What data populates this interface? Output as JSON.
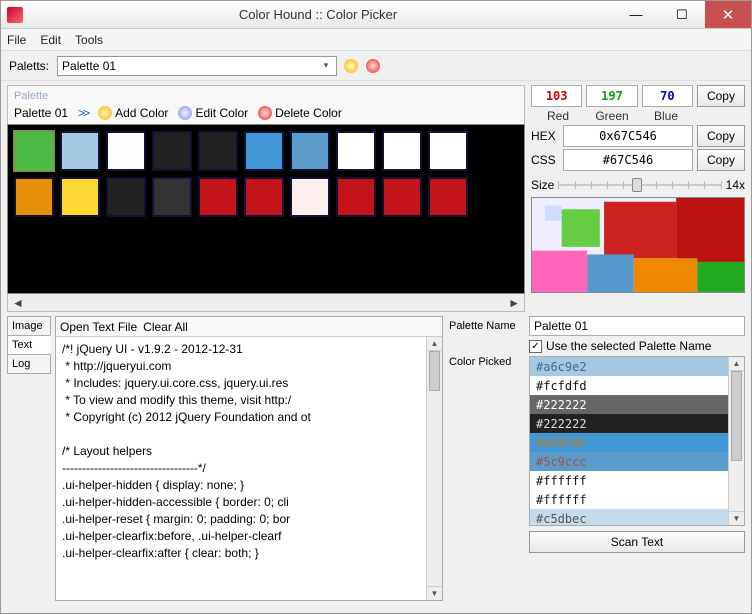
{
  "window": {
    "title": "Color Hound :: Color Picker",
    "min": "—",
    "max": "☐",
    "close": "✕"
  },
  "menu": [
    "File",
    "Edit",
    "Tools"
  ],
  "toolbar": {
    "palettes_label": "Paletts:",
    "palette_selected": "Palette 01"
  },
  "palette": {
    "group": "Palette",
    "name": "Palette 01",
    "arrows": ">>",
    "add": "Add Color",
    "edit": "Edit Color",
    "del": "Delete Color",
    "row1": [
      "#4cb944",
      "#a6c9e2",
      "#fcfdfd",
      "#222222",
      "#222222",
      "#4297d7",
      "#5c9ccc",
      "#ffffff",
      "#ffffff",
      "#ffffff"
    ],
    "row2": [
      "#e78f08",
      "#fdd835",
      "#222222",
      "#333333",
      "#c5131a",
      "#c5131a",
      "#fcefee",
      "#c5131a",
      "#c5131a",
      "#c5131a"
    ]
  },
  "rgb": {
    "r": "103",
    "g": "197",
    "b": "70",
    "rl": "Red",
    "gl": "Green",
    "bl": "Blue"
  },
  "hex": {
    "label": "HEX",
    "value": "0x67C546"
  },
  "css": {
    "label": "CSS",
    "value": "#67C546"
  },
  "copy": "Copy",
  "size": {
    "label": "Size",
    "value": "14x"
  },
  "tabs": [
    "Image",
    "Text",
    "Log"
  ],
  "text_toolbar": {
    "open": "Open Text File",
    "clear": "Clear All"
  },
  "text_body": "/*! jQuery UI - v1.9.2 - 2012-12-31\n * http://jqueryui.com\n * Includes: jquery.ui.core.css, jquery.ui.res\n * To view and modify this theme, visit http:/\n * Copyright (c) 2012 jQuery Foundation and ot\n\n/* Layout helpers\n----------------------------------*/\n.ui-helper-hidden { display: none; }\n.ui-helper-hidden-accessible { border: 0; cli\n.ui-helper-reset { margin: 0; padding: 0; bor\n.ui-helper-clearfix:before, .ui-helper-clearf\n.ui-helper-clearfix:after { clear: both; }",
  "palette_name": {
    "label": "Palette Name",
    "value": "Palette 01"
  },
  "use_sel": "Use the selected Palette Name",
  "color_picked": {
    "label": "Color Picked"
  },
  "picked": [
    {
      "hex": "#a6c9e2",
      "bg": "#a6c9e2",
      "fg": "#3a6b9a"
    },
    {
      "hex": "#fcfdfd",
      "bg": "#fcfdfd",
      "fg": "#111"
    },
    {
      "hex": "#222222",
      "bg": "#666",
      "fg": "#fff"
    },
    {
      "hex": "#222222",
      "bg": "#222",
      "fg": "#ddd"
    },
    {
      "hex": "#4297d7",
      "bg": "#4297d7",
      "fg": "#c97b1a"
    },
    {
      "hex": "#5c9ccc",
      "bg": "#5c9ccc",
      "fg": "#b04a3a"
    },
    {
      "hex": "#ffffff",
      "bg": "#ffffff",
      "fg": "#111"
    },
    {
      "hex": "#ffffff",
      "bg": "#ffffff",
      "fg": "#111"
    },
    {
      "hex": "#c5dbec",
      "bg": "#c5dbec",
      "fg": "#555"
    }
  ],
  "scan": "Scan Text"
}
